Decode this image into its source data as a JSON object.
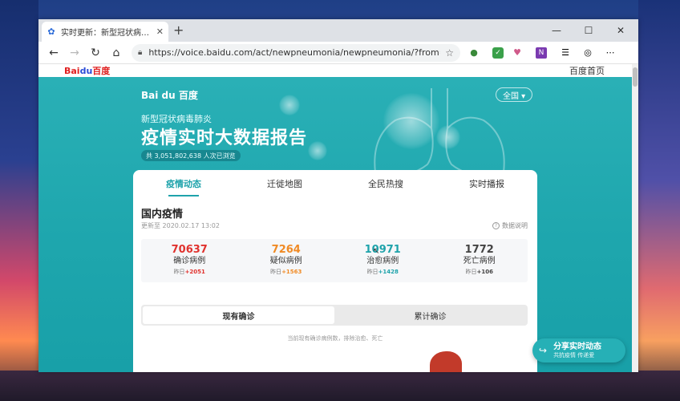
{
  "browser": {
    "tab_title": "实时更新：新型冠状病毒肺炎疫",
    "tab_close": "✕",
    "new_tab": "+",
    "url": "https://voice.baidu.com/act/newpneumonia/newpneumonia/?from=osari...",
    "controls": {
      "minimize": "—",
      "maximize": "☐",
      "close": "✕"
    },
    "icons": [
      "back-icon",
      "forward-icon",
      "refresh-icon",
      "home-icon",
      "lock-icon",
      "star-icon",
      "menu-icon"
    ]
  },
  "site": {
    "logo_small_red": "Bai",
    "logo_small_blue": "du",
    "logo_small_tail": "百度",
    "top_link": "百度首页"
  },
  "hero": {
    "logo": "Bai du 百度",
    "region_button": "全国 ▾",
    "subtitle": "新型冠状病毒肺炎",
    "title": "疫情实时大数据报告",
    "views": "共 3,051,802,638 人次已浏览"
  },
  "tabs": [
    {
      "label": "疫情动态",
      "active": true
    },
    {
      "label": "迁徙地图",
      "active": false
    },
    {
      "label": "全民热搜",
      "active": false
    },
    {
      "label": "实时播报",
      "active": false
    }
  ],
  "domestic": {
    "title": "国内疫情",
    "update_time": "更新至 2020.02.17 13:02",
    "data_note": "数据说明",
    "stats": [
      {
        "value": "70637",
        "label": "确诊病例",
        "delta_prefix": "昨日",
        "delta": "+2051",
        "color": "#e0322e"
      },
      {
        "value": "7264",
        "label": "疑似病例",
        "delta_prefix": "昨日",
        "delta": "+1563",
        "color": "#f08a24"
      },
      {
        "value": "10971",
        "label": "治愈病例",
        "delta_prefix": "昨日",
        "delta": "+1428",
        "color": "#1fa3ab"
      },
      {
        "value": "1772",
        "label": "死亡病例",
        "delta_prefix": "昨日",
        "delta": "+106",
        "color": "#444444"
      }
    ]
  },
  "toggle": {
    "options": [
      "现有确诊",
      "累计确诊"
    ],
    "active_index": 0,
    "note": "当前现有确诊病例数，排除治愈、死亡"
  },
  "share": {
    "title": "分享实时动态",
    "subtitle": "共抗疫情 传递爱"
  },
  "colors": {
    "accent": "#1fa3ab",
    "hero_bg": "#22aab0"
  }
}
